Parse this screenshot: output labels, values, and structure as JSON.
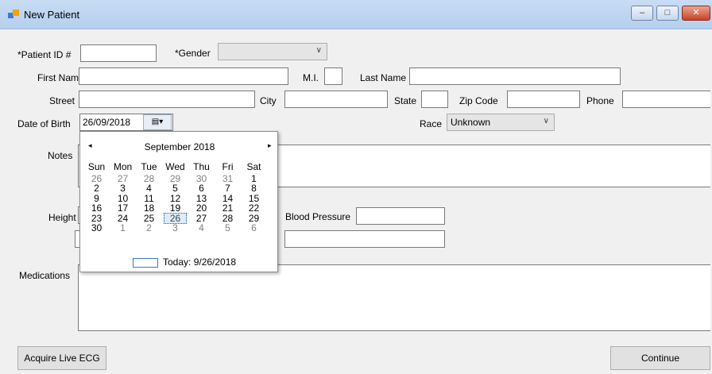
{
  "window": {
    "title": "New Patient",
    "controls": {
      "minimize": "–",
      "maximize": "□",
      "close": "✕"
    }
  },
  "form": {
    "patient_id_label": "*Patient ID #",
    "patient_id_value": "",
    "gender_label": "*Gender",
    "gender_value": "",
    "first_name_label": "First Name",
    "mi_label": "M.I.",
    "last_name_label": "Last Name",
    "street_label": "Street",
    "city_label": "City",
    "state_label": "State",
    "zip_label": "Zip Code",
    "phone_label": "Phone",
    "dob_label": "Date of Birth",
    "dob_value": "26/09/2018",
    "race_label": "Race",
    "race_value": "Unknown",
    "notes_label": "Notes",
    "height_label": "Height",
    "bp_label": "Blood Pressure",
    "medications_label": "Medications"
  },
  "calendar": {
    "month_label": "September 2018",
    "prev": "◂",
    "next": "▸",
    "weekdays": [
      "Sun",
      "Mon",
      "Tue",
      "Wed",
      "Thu",
      "Fri",
      "Sat"
    ],
    "weeks": [
      [
        {
          "d": "26",
          "o": true
        },
        {
          "d": "27",
          "o": true
        },
        {
          "d": "28",
          "o": true
        },
        {
          "d": "29",
          "o": true
        },
        {
          "d": "30",
          "o": true
        },
        {
          "d": "31",
          "o": true
        },
        {
          "d": "1"
        }
      ],
      [
        {
          "d": "2"
        },
        {
          "d": "3"
        },
        {
          "d": "4"
        },
        {
          "d": "5"
        },
        {
          "d": "6"
        },
        {
          "d": "7"
        },
        {
          "d": "8"
        }
      ],
      [
        {
          "d": "9"
        },
        {
          "d": "10"
        },
        {
          "d": "11"
        },
        {
          "d": "12"
        },
        {
          "d": "13"
        },
        {
          "d": "14"
        },
        {
          "d": "15"
        }
      ],
      [
        {
          "d": "16"
        },
        {
          "d": "17"
        },
        {
          "d": "18"
        },
        {
          "d": "19"
        },
        {
          "d": "20"
        },
        {
          "d": "21"
        },
        {
          "d": "22"
        }
      ],
      [
        {
          "d": "23"
        },
        {
          "d": "24"
        },
        {
          "d": "25"
        },
        {
          "d": "26",
          "sel": true
        },
        {
          "d": "27"
        },
        {
          "d": "28"
        },
        {
          "d": "29"
        }
      ],
      [
        {
          "d": "30"
        },
        {
          "d": "1",
          "o": true
        },
        {
          "d": "2",
          "o": true
        },
        {
          "d": "3",
          "o": true
        },
        {
          "d": "4",
          "o": true
        },
        {
          "d": "5",
          "o": true
        },
        {
          "d": "6",
          "o": true
        }
      ]
    ],
    "today_label": "Today: 9/26/2018"
  },
  "buttons": {
    "acquire_ecg": "Acquire Live ECG",
    "continue": "Continue"
  },
  "icons": {
    "dropdown_arrow": "chevron-down-icon",
    "calendar_button": "calendar-icon"
  }
}
